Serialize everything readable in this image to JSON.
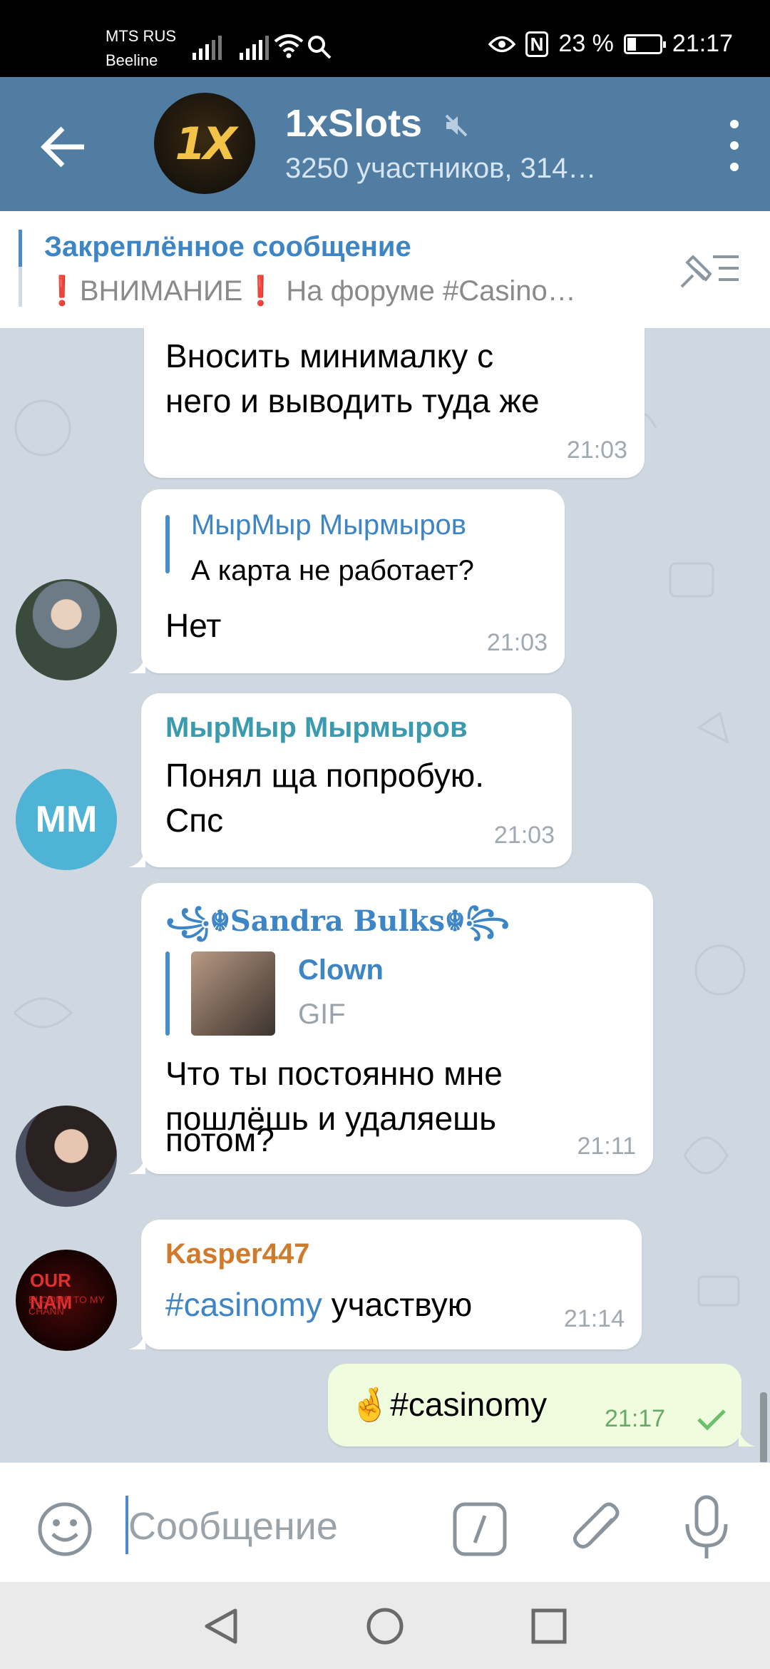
{
  "status_bar": {
    "carrier1": "MTS RUS",
    "carrier2": "Beeline",
    "nfc": "N",
    "battery": "23 %",
    "time": "21:17"
  },
  "header": {
    "avatar_text": "1X",
    "title": "1xSlots",
    "subtitle": "3250 участников, 314…"
  },
  "pinned": {
    "title": "Закреплённое сообщение",
    "text_prefix": "ВНИМАНИЕ",
    "text_rest": " На форуме #Casino…"
  },
  "messages": {
    "m1": {
      "text1": "Вносить минималку с",
      "text2": "него и выводить туда же",
      "time": "21:03"
    },
    "m2": {
      "quote_author": "МырМыр Мырмыров",
      "quote_text": "А карта не работает?",
      "text": "Нет",
      "time": "21:03"
    },
    "m3": {
      "sender": "МырМыр Мырмыров",
      "avatar": "ММ",
      "text1": "Понял ща попробую.",
      "text2": "Спс",
      "time": "21:03"
    },
    "m4": {
      "sender": "꧁☬Sandra Bulks☬꧂",
      "quote_author": "Clown",
      "quote_text": "GIF",
      "text1": "Что ты постоянно мне",
      "text2": "пошлёшь и удаляешь",
      "text3": "потом?",
      "time": "21:11"
    },
    "m5": {
      "sender": "Kasper447",
      "hashtag": "#casinomy",
      "text": " участвую",
      "time": "21:14"
    },
    "m6": {
      "emoji": "🤞",
      "text": "#casinomy",
      "time": "21:17"
    }
  },
  "input": {
    "placeholder": "Сообщение"
  },
  "colors": {
    "header": "#517da2",
    "chat_bg": "#cfd8e0",
    "outgoing_bubble": "#effdde",
    "link": "#3d85c4",
    "sender_teal": "#3a9ab0",
    "sender_orange": "#d07a2c"
  }
}
